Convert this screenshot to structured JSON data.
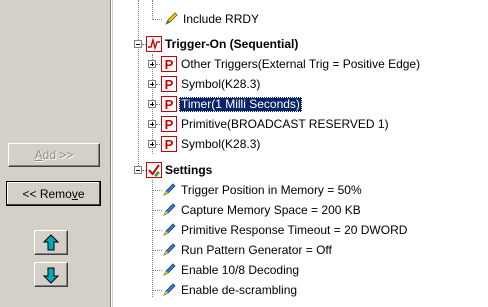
{
  "buttons": {
    "add": "Add >>",
    "remove": "<< Remove"
  },
  "tree": {
    "include_rrdy": "Include RRDY",
    "trigger_on": {
      "label": "Trigger-On (Sequential)",
      "children": [
        "Other Triggers(External Trig = Positive Edge)",
        "Symbol(K28.3)",
        "Timer(1 Milli Seconds)",
        "Primitive(BROADCAST RESERVED 1)",
        "Symbol(K28.3)"
      ]
    },
    "settings": {
      "label": "Settings",
      "children": [
        "Trigger Position in Memory = 50%",
        "Capture Memory Space = 200 KB",
        "Primitive Response Timeout = 20 DWORD",
        "Run Pattern Generator = Off",
        "Enable 10/8 Decoding",
        "Enable de-scrambling"
      ]
    }
  },
  "icons": {
    "check": "pencil-check-icon",
    "trigger": "trigger-waveform-icon",
    "pattern": "p-pattern-icon",
    "settings": "settings-check-icon",
    "setting_item": "setting-pencil-icon"
  },
  "colors": {
    "panel": "#d4d0c8",
    "selection": "#0a246a",
    "icon_red": "#cc0000",
    "icon_green": "#3aa03a",
    "icon_blue": "#3a7bd5",
    "icon_yellow": "#f5d300"
  }
}
